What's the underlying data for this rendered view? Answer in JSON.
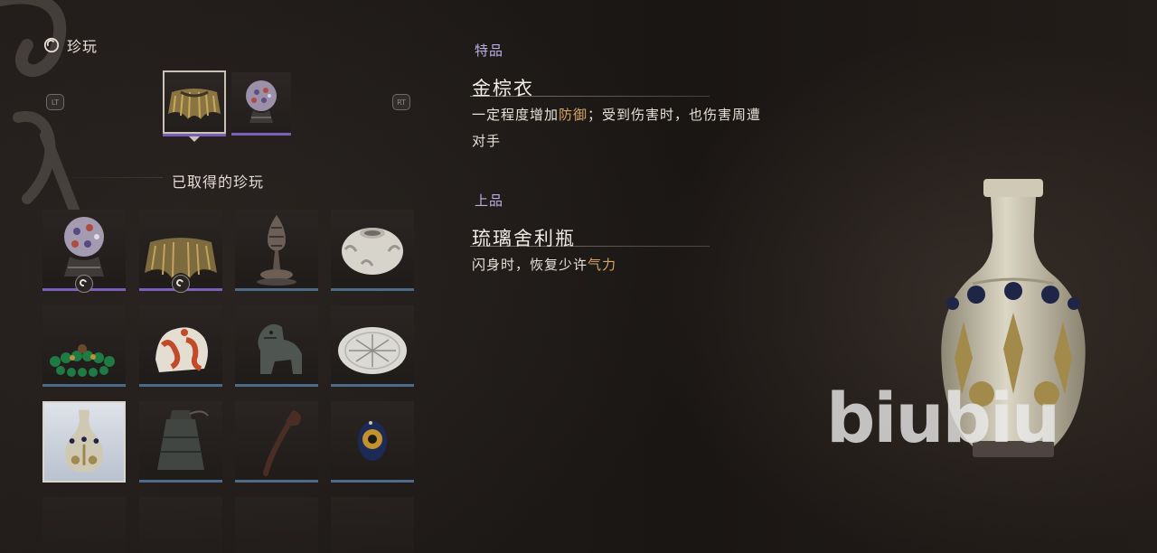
{
  "header": {
    "icon": "curio-icon",
    "title": "珍玩"
  },
  "triggers": {
    "left": "LT",
    "right": "RT"
  },
  "equipped": [
    {
      "name": "金棕衣",
      "icon": "golden-cape-icon",
      "selected": true
    },
    {
      "name": "琉璃舍利瓶",
      "icon": "glass-orb-icon",
      "selected": false
    }
  ],
  "obtained_title": "已取得的珍玩",
  "grid": [
    {
      "icon": "glass-orb-icon",
      "equipped": true
    },
    {
      "icon": "golden-cape-icon",
      "equipped": true
    },
    {
      "icon": "incense-burner-icon",
      "equipped": false
    },
    {
      "icon": "white-jar-icon",
      "equipped": false
    },
    {
      "icon": "jade-prayer-beads-icon",
      "equipped": false
    },
    {
      "icon": "coral-carving-icon",
      "equipped": false
    },
    {
      "icon": "bronze-beast-icon",
      "equipped": false
    },
    {
      "icon": "white-plate-icon",
      "equipped": false
    },
    {
      "icon": "celadon-vase-icon",
      "equipped": false,
      "selected": true
    },
    {
      "icon": "bronze-bell-icon",
      "equipped": false
    },
    {
      "icon": "wooden-ruyi-icon",
      "equipped": false
    },
    {
      "icon": "blue-eye-bead-icon",
      "equipped": false
    }
  ],
  "details": [
    {
      "grade": "特品",
      "name": "金棕衣",
      "desc_before": "一定程度增加",
      "desc_highlight": "防御",
      "desc_after_line1": "；受到伤害时，也伤害周遭",
      "desc_line2": "对手"
    },
    {
      "grade": "上品",
      "name": "琉璃舍利瓶",
      "desc_before": "闪身时，恢复少许",
      "desc_highlight": "气力"
    }
  ],
  "preview_icon": "celadon-vase-preview",
  "watermark": "biubiu",
  "colors": {
    "grade": "#b8b0e4",
    "highlight": "#d8a764",
    "equipped_bar": "#7b5fbb",
    "normal_bar": "#4d6a86"
  }
}
